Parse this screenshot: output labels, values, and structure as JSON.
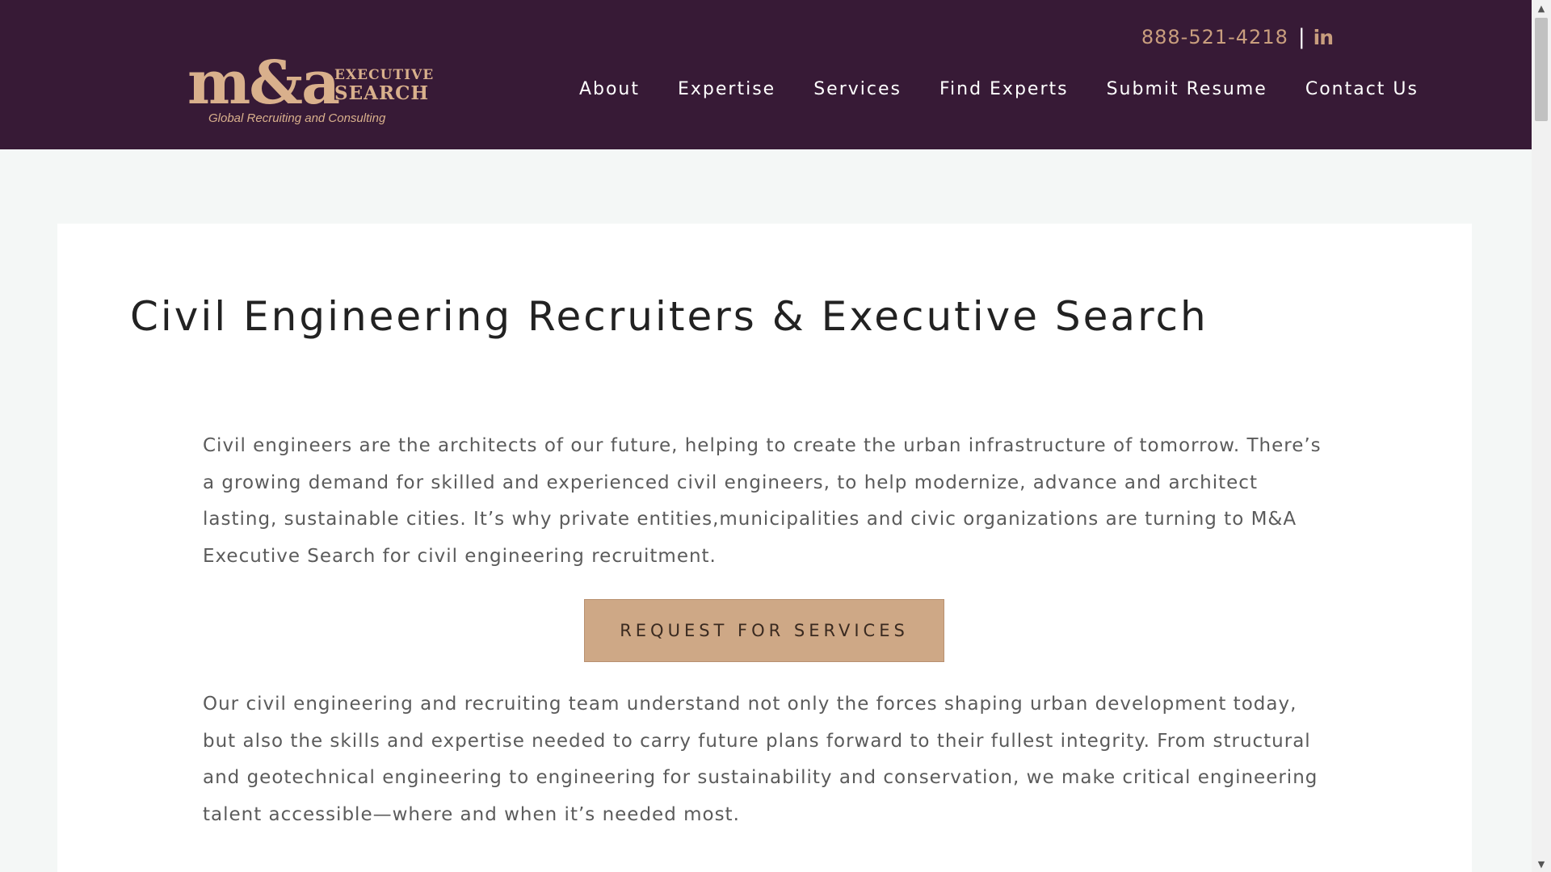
{
  "header": {
    "logo": {
      "mark": "m&a",
      "word1": "EXECUTIVE",
      "word2": "SEARCH",
      "tagline": "Global Recruiting and Consulting"
    },
    "phone": "888-521-4218",
    "separator": "|",
    "linkedin_icon_text": "in",
    "nav": [
      {
        "label": "About"
      },
      {
        "label": "Expertise"
      },
      {
        "label": "Services"
      },
      {
        "label": "Find Experts"
      },
      {
        "label": "Submit Resume"
      },
      {
        "label": "Contact Us"
      }
    ]
  },
  "main": {
    "title": "Civil Engineering Recruiters & Executive Search",
    "paragraph1": "Civil engineers are the architects of our future, helping to create the urban infrastructure of tomorrow. There’s a growing demand for skilled and experienced civil engineers, to help modernize, advance and architect lasting, sustainable cities. It’s why private entities,municipalities and civic organizations are turning to M&A Executive Search for civil engineering recruitment.",
    "cta_label": "REQUEST FOR SERVICES",
    "paragraph2": "Our civil engineering and recruiting team understand not only the forces shaping urban development today, but also the skills and expertise needed to carry future plans forward to their fullest integrity. From structural and geotechnical engineering to engineering for sustainability and conservation, we make critical engineering talent accessible—where and when it’s needed most."
  },
  "colors": {
    "header_bg": "#371a36",
    "accent": "#cea886",
    "page_bg": "#f4f7f6"
  },
  "icons": {
    "linkedin": "linkedin-icon",
    "scroll_up": "scroll-up-arrow-icon",
    "scroll_down": "scroll-down-arrow-icon"
  }
}
